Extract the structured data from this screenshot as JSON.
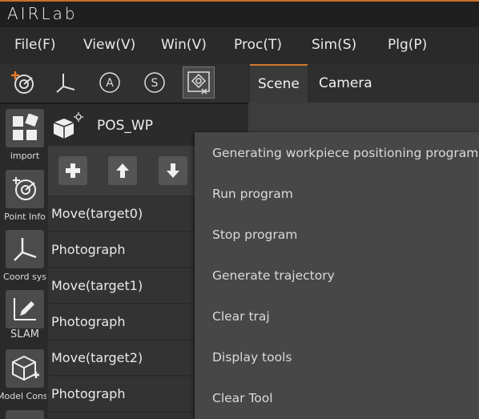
{
  "app": {
    "title": "AIRLab"
  },
  "menubar": {
    "items": [
      {
        "label": "File(F)"
      },
      {
        "label": "View(V)"
      },
      {
        "label": "Win(V)"
      },
      {
        "label": "Proc(T)"
      },
      {
        "label": "Sim(S)"
      },
      {
        "label": "Plg(P)"
      }
    ]
  },
  "toolbar": {
    "icons": [
      "target-plus-icon",
      "axis-icon",
      "circle-a-icon",
      "circle-s-icon",
      "cross-tool-icon"
    ],
    "glyph_a": "A",
    "glyph_s": "S"
  },
  "tabs": [
    {
      "label": "Scene",
      "active": true
    },
    {
      "label": "Camera",
      "active": false
    }
  ],
  "sidebar": {
    "items": [
      {
        "label": "import"
      },
      {
        "label": "Point Info"
      },
      {
        "label": "Coord sys"
      },
      {
        "label": "SLAM"
      },
      {
        "label": "Model Cons"
      }
    ]
  },
  "program": {
    "name": "POS_WP",
    "steps": [
      {
        "label": "Move(target0)"
      },
      {
        "label": "Photograph"
      },
      {
        "label": "Move(target1)"
      },
      {
        "label": "Photograph"
      },
      {
        "label": "Move(target2)"
      },
      {
        "label": "Photograph"
      }
    ]
  },
  "context_menu": {
    "items": [
      {
        "label": "Generating workpiece positioning program"
      },
      {
        "label": "Run program"
      },
      {
        "label": "Stop program"
      },
      {
        "label": "Generate trajectory"
      },
      {
        "label": "Clear traj"
      },
      {
        "label": "Display tools"
      },
      {
        "label": "Clear Tool"
      }
    ]
  },
  "colors": {
    "accent": "#d07a2c",
    "menu_bg": "#474747",
    "panel_bg": "#333333"
  }
}
